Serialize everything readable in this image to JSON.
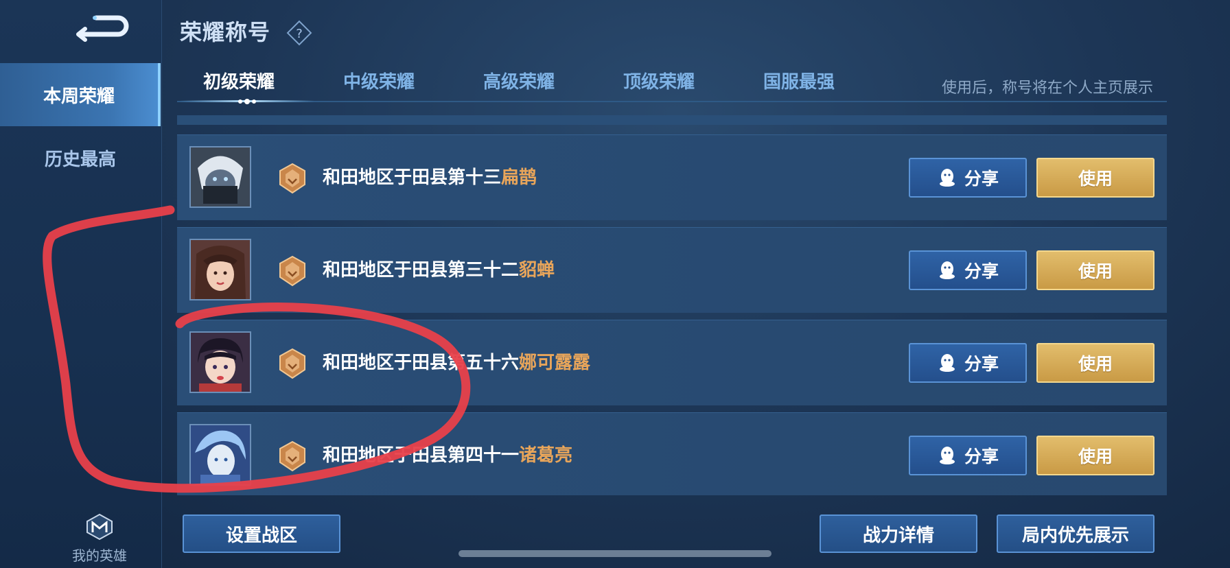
{
  "sidebar": {
    "items": [
      {
        "label": "本周荣耀",
        "active": true
      },
      {
        "label": "历史最高",
        "active": false
      }
    ],
    "my_hero_label": "我的英雄"
  },
  "header": {
    "title": "荣耀称号",
    "hint": "使用后，称号将在个人主页展示"
  },
  "tabs": [
    {
      "label": "初级荣耀",
      "active": true
    },
    {
      "label": "中级荣耀",
      "active": false
    },
    {
      "label": "高级荣耀",
      "active": false
    },
    {
      "label": "顶级荣耀",
      "active": false
    },
    {
      "label": "国服最强",
      "active": false
    }
  ],
  "rows": [
    {
      "title_prefix": "和田地区于田县第十三",
      "hero": "扁鹊",
      "share_label": "分享",
      "use_label": "使用"
    },
    {
      "title_prefix": "和田地区于田县第三十二",
      "hero": "貂蝉",
      "share_label": "分享",
      "use_label": "使用"
    },
    {
      "title_prefix": "和田地区于田县第五十六",
      "hero": "娜可露露",
      "share_label": "分享",
      "use_label": "使用"
    },
    {
      "title_prefix": "和田地区于田县第四十一",
      "hero": "诸葛亮",
      "share_label": "分享",
      "use_label": "使用"
    }
  ],
  "bottom": {
    "set_zone_label": "设置战区",
    "power_details_label": "战力详情",
    "priority_display_label": "局内优先展示"
  },
  "colors": {
    "hero_name": "#e8a55a",
    "use_button": "#d8ad5b",
    "share_button": "#2a5a98",
    "annotation": "#e8404a"
  }
}
